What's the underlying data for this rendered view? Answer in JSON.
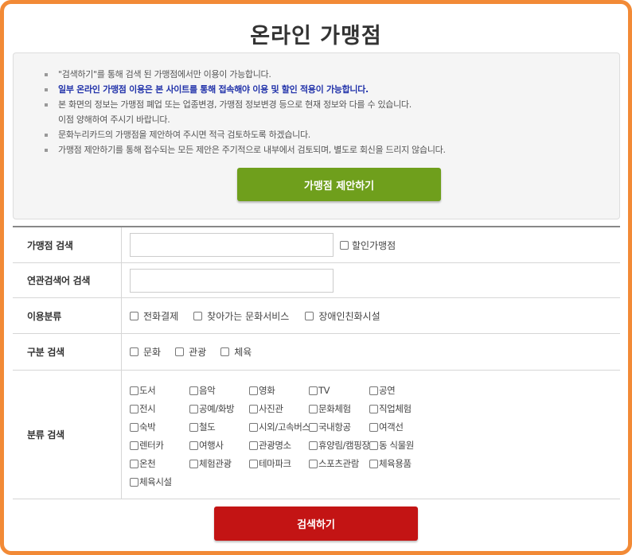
{
  "title": "온라인 가맹점",
  "notice": {
    "items": [
      "\"검색하기\"를 통해 검색 된 가맹점에서만 이용이 가능합니다.",
      "일부 온라인 가맹점 이용은 본 사이트를 통해 접속해야 이용 및 할인 적용이 가능합니다.",
      "본 화면의 정보는 가맹점 폐업 또는 업종변경, 가맹점 정보변경 등으로 현재 정보와 다를 수 있습니다.",
      "이점 양해하여 주시기 바랍니다.",
      "문화누리카드의 가맹점을 제안하여 주시면 적극 검토하도록 하겠습니다.",
      "가맹점 제안하기를 통해 접수되는 모든 제안은 주기적으로 내부에서 검토되며, 별도로 회신을 드리지 않습니다."
    ],
    "suggest_button": "가맹점 제안하기"
  },
  "form": {
    "store_search": {
      "label": "가맹점 검색",
      "input_value": "",
      "checkbox_label": "할인가맹점"
    },
    "keyword_search": {
      "label": "연관검색어 검색",
      "input_value": ""
    },
    "usage_type": {
      "label": "이용분류",
      "options": [
        "전화결제",
        "찾아가는 문화서비스",
        "장애인친화시설"
      ]
    },
    "division": {
      "label": "구분 검색",
      "options": [
        "문화",
        "관광",
        "체육"
      ]
    },
    "category": {
      "label": "분류 검색",
      "options": [
        "도서",
        "음악",
        "영화",
        "TV",
        "공연",
        "전시",
        "공예/화방",
        "사진관",
        "문화체험",
        "직업체험",
        "숙박",
        "철도",
        "시외/고속버스",
        "국내항공",
        "여객선",
        "렌터카",
        "여행사",
        "관광명소",
        "휴양림/캠핑장",
        "동 식물원",
        "온천",
        "체험관광",
        "테마파크",
        "스포츠관람",
        "체육용품",
        "체육시설"
      ]
    }
  },
  "search_button": "검색하기",
  "colors": {
    "frame": "#f28a36",
    "suggest": "#6f9f1c",
    "search": "#c31414",
    "highlight": "#2233aa"
  }
}
